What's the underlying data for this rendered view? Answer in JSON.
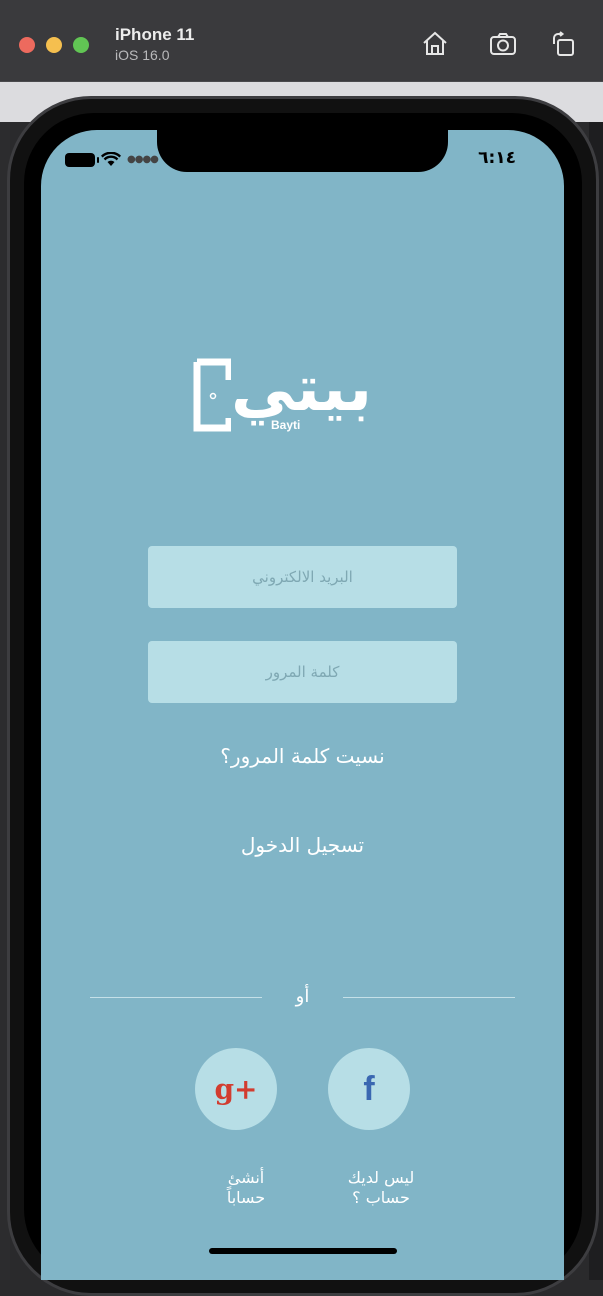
{
  "simulator": {
    "device": "iPhone 11",
    "os": "iOS 16.0"
  },
  "status_bar": {
    "time": "٦:١٤"
  },
  "logo": {
    "arabic": "بيتي",
    "latin": "Bayti"
  },
  "login": {
    "email_placeholder": "البريد الالكتروني",
    "password_placeholder": "كلمة المرور",
    "forgot_password": "نسيت كلمة المرور؟",
    "login_button": "تسجيل الدخول",
    "or": "أو"
  },
  "social": {
    "google_label": "g+",
    "facebook_label": "f",
    "create_account": "أنشئ حساباً",
    "no_account": "ليس لديك حساب ؟"
  },
  "colors": {
    "background": "#81b5c7",
    "field": "#b7dee6",
    "google": "#d23c2f",
    "facebook": "#3a67b1"
  }
}
